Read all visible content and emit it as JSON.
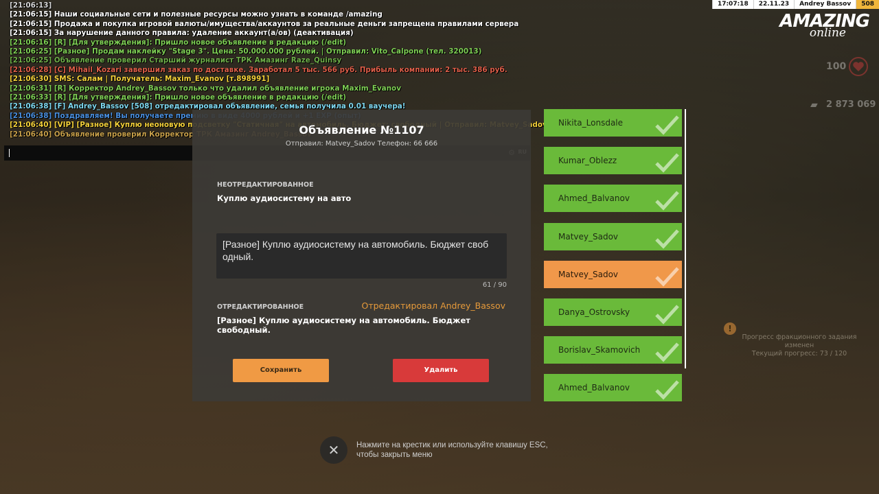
{
  "hud": {
    "time": "17:07:18",
    "date": "22.11.23",
    "player": "Andrey Bassov",
    "level": "508",
    "logo_main": "AMAZING",
    "logo_sub": "online",
    "health": "100",
    "money": "2 873 069"
  },
  "chat": {
    "lines": [
      {
        "text": "[21:06:13]",
        "color": "#d8d8d8"
      },
      {
        "text": "[21:06:15] Наши социальные сети и полезные ресурсы можно узнать в команде /amazing",
        "color": "#ffffff"
      },
      {
        "text": "[21:06:15] Продажа и покупка игровой валюты/имущества/аккаунтов за реальные деньги запрещена правилами сервера",
        "color": "#ffffff"
      },
      {
        "text": "[21:06:15] За нарушение данного правила: удаление аккаунт(а/ов) (деактивация)",
        "color": "#ffffff"
      },
      {
        "text": "[21:06:16] [R] [Для утверждения]: Пришло новое объявление в редакцию (/edit)",
        "color": "#7fcf55"
      },
      {
        "text": "[21:06:25] [Разное] Продам наклейку \"Stage 3\". Цена: 50.000.000 рублей. | Отправил: Vito_Calpone (тел. 320013)",
        "color": "#7fcf55"
      },
      {
        "text": "[21:06:25] Объявление проверил Старший журналист ТРК Амазинг Raze_Quinsy",
        "color": "#6fb04a"
      },
      {
        "text": "[21:06:28] [C] Mihail_Kozari завершил заказ по доставке. Заработал 5 тыс. 566 руб. Прибыль компании: 2 тыс. 386 руб.",
        "color": "#e0604a"
      },
      {
        "text": "[21:06:30] SMS: Салам | Получатель: Maxim_Evanov [т.898991]",
        "color": "#f5d23a"
      },
      {
        "text": "[21:06:31] [R] Корректор Andrey_Bassov только что удалил объявление игрока Maxim_Evanov",
        "color": "#7fcf55"
      },
      {
        "text": "[21:06:33] [R] [Для утверждения]: Пришло новое объявление в редакцию (/edit)",
        "color": "#7fcf55"
      },
      {
        "text": "[21:06:38] [F] Andrey_Bassov [508] отредактировал объявление, семья получила 0.01 ваучера!",
        "color": "#7fd8f0"
      },
      {
        "text": "[21:06:38] Поздравляем! Вы получаете премию в виде 4000 рублей и +1 EXP (опыт)",
        "color": "#4a90e0"
      },
      {
        "text": "[21:06:40] [VIP] [Разное] Куплю неоновую подсветку \"Статичная\" на автомобиль. Бюджет: свободный | Отправил: Matvey_Sadov (тел. 66666)",
        "color": "#f5d23a"
      },
      {
        "text": "[21:06:40] Объявление проверил Корректор ТРК Амазинг Andrey_Bassov",
        "color": "#c8a04a"
      }
    ],
    "input_lang": "RU"
  },
  "dialog": {
    "title": "Объявление №1107",
    "subtitle": "Отправил: Matvey_Sadov Телефон: 66 666",
    "original_label": "НЕОТРЕДАКТИРОВАННОЕ",
    "original_text": "Куплю аудиосистему на авто",
    "edit_value": "[Разное] Куплю аудиосистему на автомобиль. Бюджет своб одный.",
    "char_count": "61 / 90",
    "edited_label": "ОТРЕДАКТИРОВАННОЕ",
    "edited_by": "Отредактировал Andrey_Bassov",
    "edited_text": "[Разное] Куплю аудиосистему на автомобиль. Бюджет свободный.",
    "save_label": "Сохранить",
    "delete_label": "Удалить"
  },
  "ad_list": {
    "items": [
      {
        "name": "Nikita_Lonsdale",
        "active": false
      },
      {
        "name": "Kumar_Oblezz",
        "active": false
      },
      {
        "name": "Ahmed_Balvanov",
        "active": false
      },
      {
        "name": "Matvey_Sadov",
        "active": false
      },
      {
        "name": "Matvey_Sadov",
        "active": true
      },
      {
        "name": "Danya_Ostrovsky",
        "active": false
      },
      {
        "name": "Borislav_Skamovich",
        "active": false
      },
      {
        "name": "Ahmed_Balvanov",
        "active": false
      }
    ]
  },
  "notification": {
    "line1": "Прогресс фракционного задания",
    "line2": "изменен",
    "line3": "Текущий прогресс: 73 / 120"
  },
  "close_hint": {
    "icon": "close-icon",
    "text": "Нажмите на крестик или используйте клавишу ESC, чтобы закрыть меню"
  },
  "colors": {
    "accent_orange": "#f0984a",
    "accent_green": "#6aba3a",
    "danger_red": "#d83a3a"
  }
}
